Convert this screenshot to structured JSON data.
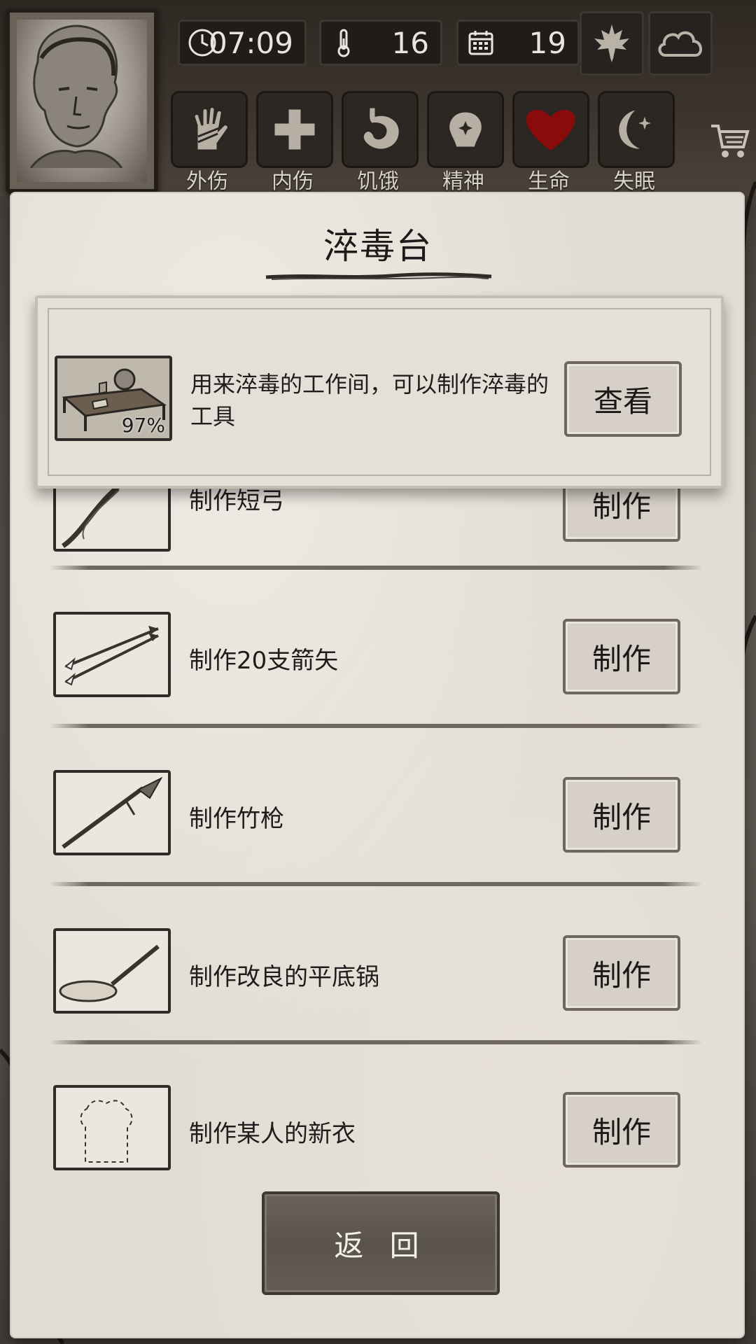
{
  "hud": {
    "time": "07:09",
    "temperature": "16",
    "day": "19",
    "season_icon": "maple-leaf-icon",
    "weather_icon": "cloud-icon"
  },
  "status_bar": [
    {
      "label": "外伤",
      "icon": "hand-bandage-icon"
    },
    {
      "label": "内伤",
      "icon": "cross-icon"
    },
    {
      "label": "饥饿",
      "icon": "stomach-icon"
    },
    {
      "label": "精神",
      "icon": "head-sparkle-icon"
    },
    {
      "label": "生命",
      "icon": "heart-icon",
      "color": "#8a0b0b"
    },
    {
      "label": "失眠",
      "icon": "moon-star-icon"
    }
  ],
  "panel": {
    "title": "淬毒台",
    "info": {
      "description": "用来淬毒的工作间，可以制作淬毒的工具",
      "progress": "97%",
      "button": "查看"
    },
    "recipes": [
      {
        "label": "制作短弓",
        "button": "制作",
        "icon": "bow-icon"
      },
      {
        "label": "制作20支箭矢",
        "button": "制作",
        "icon": "arrows-icon"
      },
      {
        "label": "制作竹枪",
        "button": "制作",
        "icon": "spear-icon"
      },
      {
        "label": "制作改良的平底锅",
        "button": "制作",
        "icon": "pan-icon"
      },
      {
        "label": "制作某人的新衣",
        "button": "制作",
        "icon": "shirt-outline-icon"
      }
    ],
    "back_button": "返 回"
  }
}
